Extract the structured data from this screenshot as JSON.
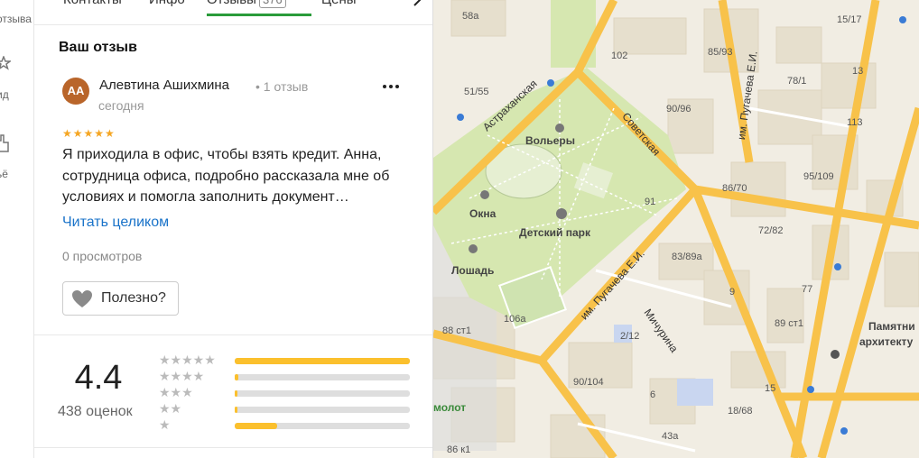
{
  "rail": {
    "items": [
      {
        "label": "отзыва",
        "icon": "review-icon"
      },
      {
        "label": "ид",
        "icon": "star-icon"
      },
      {
        "label": "ьё",
        "icon": "hand-icon"
      }
    ]
  },
  "tabs": {
    "items": [
      {
        "label": "Контакты"
      },
      {
        "label": "Инфо"
      },
      {
        "label": "Отзывы",
        "count": "376",
        "active": true
      },
      {
        "label": "Цены"
      }
    ],
    "next_icon": "chevron-right-icon"
  },
  "review": {
    "section_title": "Ваш отзыв",
    "author_initials": "АА",
    "author_name": "Алевтина Ашихмина",
    "author_reviews": "• 1 отзыв",
    "date": "сегодня",
    "stars": "★★★★★",
    "text": "Я приходила в офис, чтобы взять кредит. Анна, сотрудница офиса, подробно рассказала мне об условиях и помогла заполнить документ…",
    "read_more": "Читать целиком",
    "views": "0 просмотров",
    "useful_label": "Полезно?",
    "more_icon": "more-dots-icon"
  },
  "rating_summary": {
    "value": "4.4",
    "count_label": "438 оценок",
    "histogram": [
      {
        "stars": "★★★★★",
        "fraction": 1.0
      },
      {
        "stars": "★★★★",
        "fraction": 0.02
      },
      {
        "stars": "★★★",
        "fraction": 0.015
      },
      {
        "stars": "★★",
        "fraction": 0.015
      },
      {
        "stars": "★",
        "fraction": 0.24
      }
    ]
  },
  "map": {
    "colors": {
      "road": "#fbbf3c",
      "park": "#d6e7b0",
      "block": "#ebe4d3"
    },
    "labels": {
      "n58a": "58а",
      "n102": "102",
      "n8593": "85/93",
      "n1517": "15/17",
      "n781": "78/1",
      "n13": "13",
      "n5155": "51/55",
      "n9096": "90/96",
      "n113": "113",
      "n95109": "95/109",
      "n8670": "86/70",
      "n91": "91",
      "n7282": "72/82",
      "n8389a": "83/89а",
      "n9": "9",
      "n77": "77",
      "n89": "89 ст1",
      "n106a": "106а",
      "n88": "88 ст1",
      "n212": "2/12",
      "n90104": "90/104",
      "n6": "6",
      "n15": "15",
      "n1868": "18/68",
      "n43a": "43а",
      "n86": "86 к1",
      "volery": "Вольеры",
      "okna": "Окна",
      "park": "Детский парк",
      "loshad": "Лошадь",
      "pamyatnik": "Памятни",
      "arkhitektu": "архитекту",
      "molot": "молот",
      "astrakhanskaya": "Астраханская",
      "sovetskaya": "Советская",
      "pugacheva1": "им. Пугачева Е.И.",
      "pugacheva2": "им. Пугачева Е.И.",
      "michurina": "Мичурина"
    }
  }
}
